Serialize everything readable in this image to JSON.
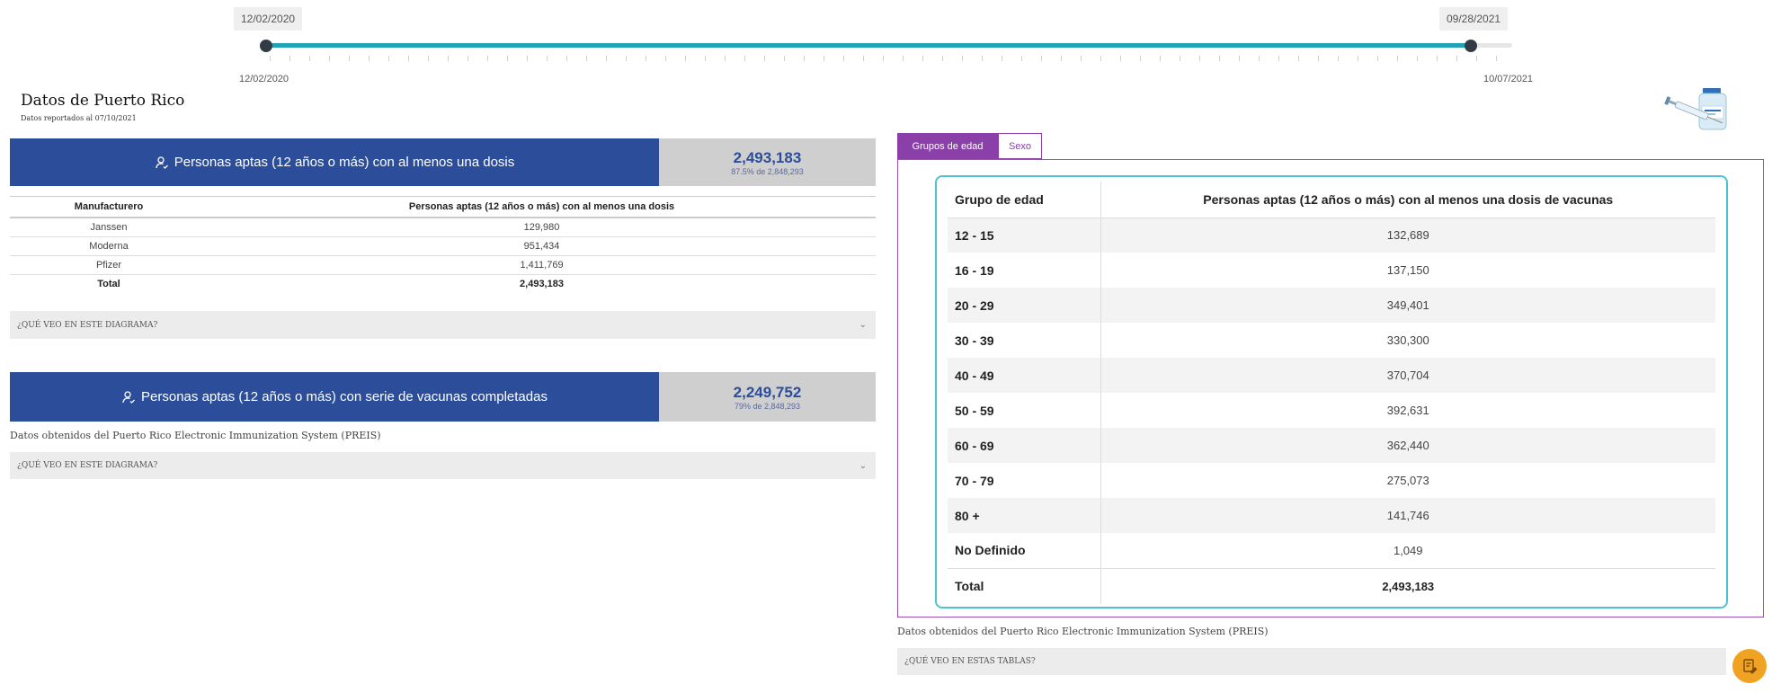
{
  "slider": {
    "start_badge": "12/02/2020",
    "end_badge": "09/28/2021",
    "min_label": "12/02/2020",
    "max_label": "10/07/2021"
  },
  "header": {
    "title": "Datos de Puerto Rico",
    "subtitle": "Datos reportados al 07/10/2021"
  },
  "banner1": {
    "label": "Personas aptas (12 años o más) con al menos una dosis",
    "value": "2,493,183",
    "sub": "87.5% de 2,848,293"
  },
  "manufacturer_table": {
    "headers": [
      "Manufacturero",
      "Personas aptas (12 años o más) con al menos una dosis"
    ],
    "rows": [
      [
        "Janssen",
        "129,980"
      ],
      [
        "Moderna",
        "951,434"
      ],
      [
        "Pfizer",
        "1,411,769"
      ]
    ],
    "total": [
      "Total",
      "2,493,183"
    ]
  },
  "accordion1": {
    "label": "¿QUÉ VEO EN ESTE DIAGRAMA?"
  },
  "banner2": {
    "label": "Personas aptas (12 años o más) con serie de vacunas completadas",
    "value": "2,249,752",
    "sub": "79% de 2,848,293"
  },
  "source_left": "Datos obtenidos del Puerto Rico Electronic Immunization System (PREIS)",
  "accordion2": {
    "label": "¿QUÉ VEO EN ESTE DIAGRAMA?"
  },
  "tabs": {
    "age": "Grupos de edad",
    "sex": "Sexo"
  },
  "age_table": {
    "headers": [
      "Grupo de edad",
      "Personas aptas (12 años o más) con al menos una dosis de vacunas"
    ],
    "rows": [
      [
        "12 - 15",
        "132,689"
      ],
      [
        "16 - 19",
        "137,150"
      ],
      [
        "20 - 29",
        "349,401"
      ],
      [
        "30 - 39",
        "330,300"
      ],
      [
        "40 - 49",
        "370,704"
      ],
      [
        "50 - 59",
        "392,631"
      ],
      [
        "60 - 69",
        "362,440"
      ],
      [
        "70 - 79",
        "275,073"
      ],
      [
        "80 +",
        "141,746"
      ],
      [
        "No Definido",
        "1,049"
      ]
    ],
    "total": [
      "Total",
      "2,493,183"
    ]
  },
  "source_right": "Datos obtenidos del Puerto Rico Electronic Immunization System (PREIS)",
  "accordion3": {
    "label": "¿QUÉ VEO EN ESTAS TABLAS?"
  },
  "colors": {
    "banner_blue": "#2b4d9a",
    "accent_teal": "#22a2b5",
    "tab_purple": "#8b3fa8",
    "fab_orange": "#f0a322"
  },
  "icons": {
    "person": "person-check-icon",
    "fab": "document-edit-icon",
    "chevron": "chevron-down-icon"
  }
}
